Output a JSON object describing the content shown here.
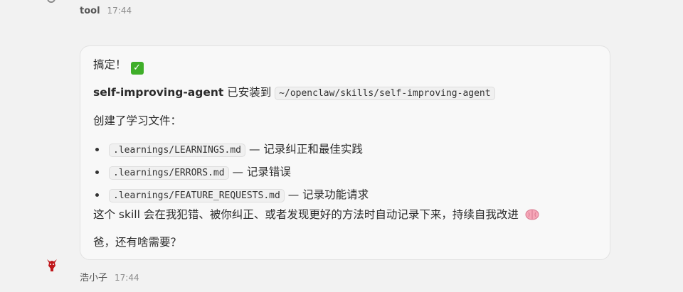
{
  "header": {
    "sender": "tool",
    "time": "17:44"
  },
  "message": {
    "line1": "搞定！",
    "line2_bold": "self-improving-agent",
    "line2_text": " 已安装到 ",
    "line2_code": "~/openclaw/skills/self-improving-agent",
    "line3": "创建了学习文件：",
    "files": [
      {
        "path": ".learnings/LEARNINGS.md",
        "desc": " — 记录纠正和最佳实践"
      },
      {
        "path": ".learnings/ERRORS.md",
        "desc": " — 记录错误"
      },
      {
        "path": ".learnings/FEATURE_REQUESTS.md",
        "desc": " — 记录功能请求"
      }
    ],
    "line7": "这个 skill 会在我犯错、被你纠正、或者发现更好的方法时自动记录下来，持续自我改进",
    "line8": "爸，还有啥需要？",
    "icons": [
      "checkmark-icon",
      "brain-icon"
    ]
  },
  "footer": {
    "sender": "浩小子",
    "time": "17:44"
  },
  "colors": {
    "check": "#3fae29",
    "bubble": "#f8f8f8",
    "background": "#f2f2f2"
  }
}
